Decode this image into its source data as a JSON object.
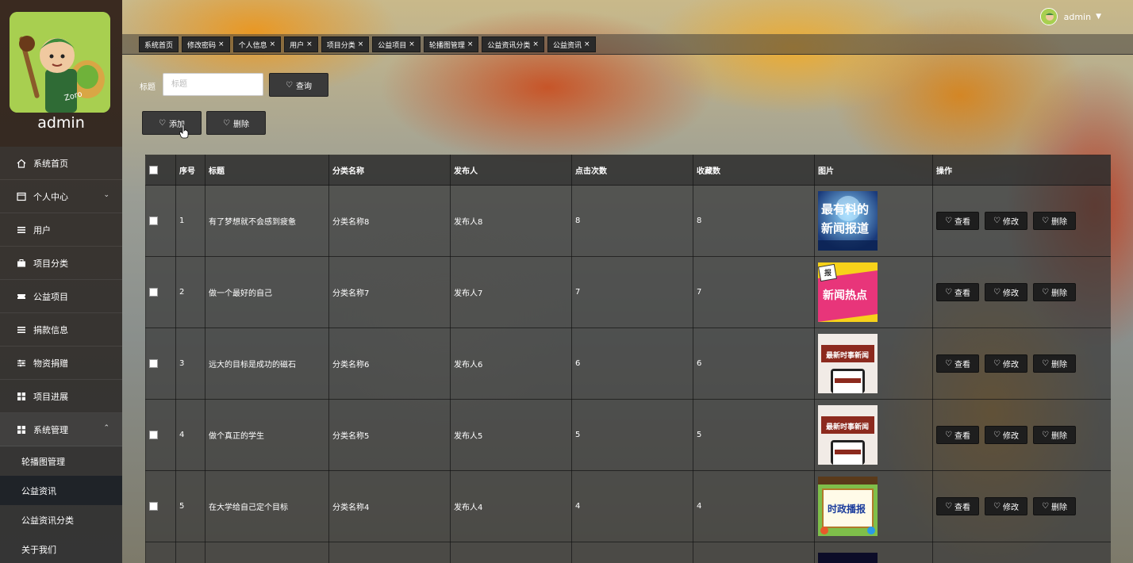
{
  "sidebar": {
    "username": "admin",
    "menu": [
      {
        "label": "系统首页",
        "icon": "home-icon"
      },
      {
        "label": "个人中心",
        "icon": "window-icon",
        "expandable": true
      },
      {
        "label": "用户",
        "icon": "list-icon"
      },
      {
        "label": "项目分类",
        "icon": "briefcase-icon"
      },
      {
        "label": "公益项目",
        "icon": "ticket-icon"
      },
      {
        "label": "捐款信息",
        "icon": "list-icon"
      },
      {
        "label": "物资捐赠",
        "icon": "sliders-icon"
      },
      {
        "label": "项目进展",
        "icon": "grid-icon"
      }
    ],
    "system_menu": {
      "label": "系统管理",
      "icon": "grid-icon"
    },
    "submenu": [
      "轮播图管理",
      "公益资讯",
      "公益资讯分类",
      "关于我们"
    ],
    "active_submenu": "公益资讯"
  },
  "header": {
    "username": "admin"
  },
  "tabs": [
    "系统首页",
    "修改密码",
    "个人信息",
    "用户",
    "项目分类",
    "公益项目",
    "轮播图管理",
    "公益资讯分类",
    "公益资讯"
  ],
  "search": {
    "label": "标题",
    "placeholder": "标题",
    "query_button": "查询"
  },
  "actions": {
    "add": "添加",
    "delete": "删除"
  },
  "table": {
    "columns": [
      "序号",
      "标题",
      "分类名称",
      "发布人",
      "点击次数",
      "收藏数",
      "图片",
      "操作"
    ],
    "rows": [
      {
        "index": "1",
        "title": "有了梦想就不会感到疲惫",
        "category": "分类名称8",
        "publisher": "发布人8",
        "clicks": "8",
        "favorites": "8",
        "image": "news-report-image",
        "image_text": "最有料的新闻报道"
      },
      {
        "index": "2",
        "title": "做一个最好的自己",
        "category": "分类名称7",
        "publisher": "发布人7",
        "clicks": "7",
        "favorites": "7",
        "image": "hot-news-image",
        "image_text": "新闻热点"
      },
      {
        "index": "3",
        "title": "远大的目标是成功的磁石",
        "category": "分类名称6",
        "publisher": "发布人6",
        "clicks": "6",
        "favorites": "6",
        "image": "latest-news-image",
        "image_text": "最新时事新闻"
      },
      {
        "index": "4",
        "title": "做个真正的学生",
        "category": "分类名称5",
        "publisher": "发布人5",
        "clicks": "5",
        "favorites": "5",
        "image": "latest-news-image",
        "image_text": "最新时事新闻"
      },
      {
        "index": "5",
        "title": "在大学给自己定个目标",
        "category": "分类名称4",
        "publisher": "发布人4",
        "clicks": "4",
        "favorites": "4",
        "image": "politics-broadcast-image",
        "image_text": "时政播报"
      }
    ],
    "row_actions": {
      "view": "查看",
      "edit": "修改",
      "delete": "删除"
    }
  },
  "colors": {
    "sidebar_bg": "#352a22",
    "active_submenu_bg": "#1f2328",
    "avatar_bg": "#a8cf50",
    "button_bg": "#3a3a3a"
  }
}
